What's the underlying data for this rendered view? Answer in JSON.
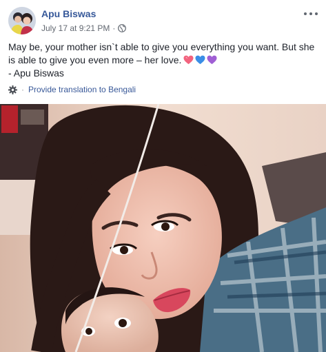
{
  "post": {
    "author": "Apu Biswas",
    "timestamp": "July 17 at 9:21 PM",
    "meta_separator": "·",
    "privacy_icon": "globe-icon",
    "more_icon": "more-options-icon",
    "text_line1": "May be, your mother isn`t able to give you everything you want. But she",
    "text_line2": "is able to give you even more – her love.",
    "text_line3": "- Apu Biswas",
    "emojis": [
      "heart-pink",
      "heart-blue",
      "heart-purple"
    ],
    "translate_label": "Provide translation to Bengali",
    "translate_separator": "·",
    "colors": {
      "link": "#365899",
      "meta": "#616770",
      "heart_pink": "#f2637e",
      "heart_blue": "#3a8ee6",
      "heart_purple": "#a05fd4"
    }
  }
}
